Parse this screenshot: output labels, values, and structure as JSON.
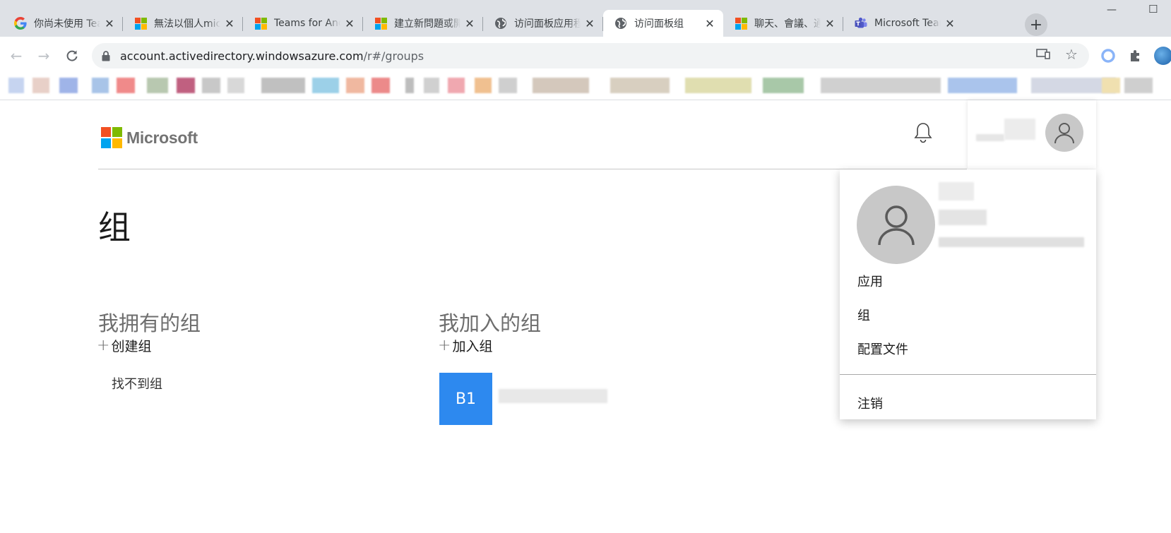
{
  "browser": {
    "tabs": [
      {
        "title": "你尚未使用 Teams",
        "favicon": "google-g-icon",
        "active": false
      },
      {
        "title": "無法以個人microsoft",
        "favicon": "microsoft-icon",
        "active": false
      },
      {
        "title": "Teams for Android",
        "favicon": "microsoft-icon",
        "active": false
      },
      {
        "title": "建立新問題或開啟",
        "favicon": "microsoft-icon",
        "active": false
      },
      {
        "title": "访问面板应用程序",
        "favicon": "globe-icon",
        "active": false
      },
      {
        "title": "访问面板组",
        "favicon": "globe-icon",
        "active": true
      },
      {
        "title": "聊天、會議、通話",
        "favicon": "microsoft-icon",
        "active": false
      },
      {
        "title": "Microsoft Teams",
        "favicon": "teams-icon",
        "active": false
      }
    ],
    "url_host": "account.activedirectory.windowsazure.com",
    "url_path": "/r#/groups"
  },
  "header": {
    "logo_text": "Microsoft"
  },
  "page": {
    "title": "组",
    "owned": {
      "heading": "我拥有的组",
      "action": "创建组",
      "empty_text": "找不到组"
    },
    "joined": {
      "heading": "我加入的组",
      "action": "加入组",
      "groups": [
        {
          "initials": "B1"
        }
      ]
    }
  },
  "menu": {
    "items": [
      "应用",
      "组",
      "配置文件"
    ],
    "signout": "注销"
  },
  "colors": {
    "ms_red": "#f25022",
    "ms_green": "#7fba00",
    "ms_blue": "#00a4ef",
    "ms_yellow": "#ffb900",
    "group_tile": "#2d89ef"
  }
}
